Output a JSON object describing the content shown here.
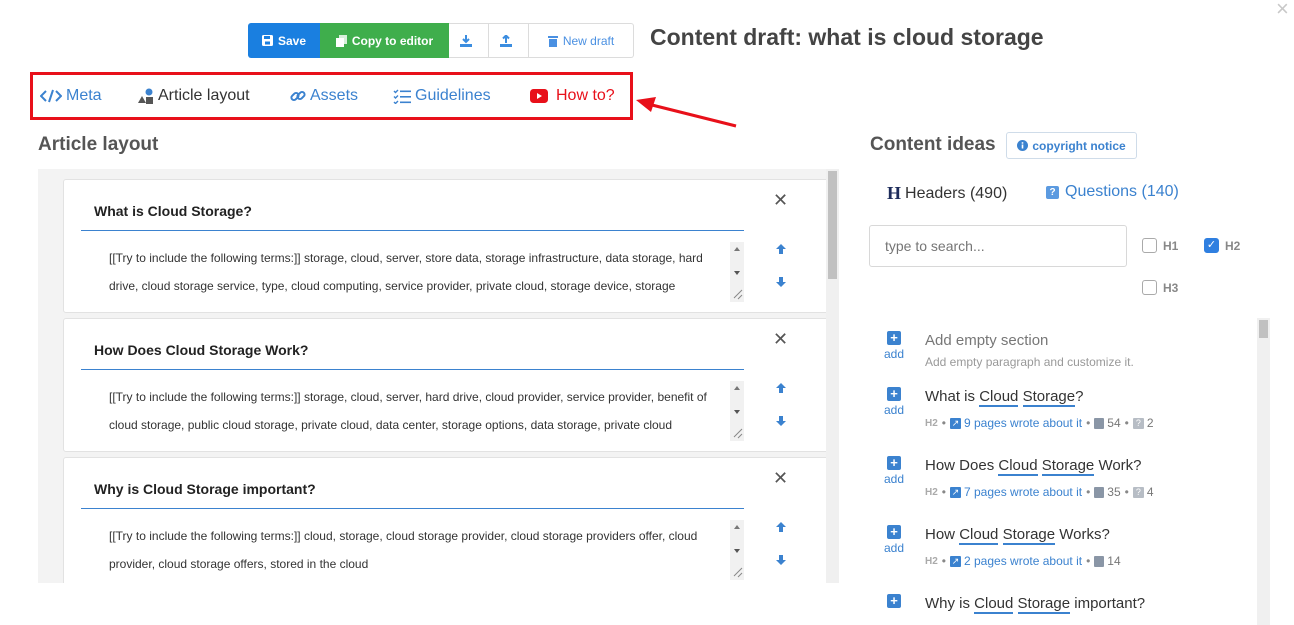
{
  "window": {
    "close_glyph": "×"
  },
  "toolbar": {
    "save_label": "Save",
    "copy_label": "Copy to editor",
    "new_draft_label": "New draft"
  },
  "page_title": "Content draft: what is cloud storage",
  "nav": {
    "meta": "Meta",
    "article_layout": "Article layout",
    "assets": "Assets",
    "guidelines": "Guidelines",
    "how_to": "How to?"
  },
  "layout": {
    "heading": "Article layout",
    "cards": [
      {
        "title": "What is Cloud Storage?",
        "text": "[[Try to include the following terms:]] storage, cloud, server, store data, storage infrastructure, data storage, hard drive, cloud storage service, type, cloud computing, service provider, private cloud, storage device, storage"
      },
      {
        "title": "How Does Cloud Storage Work?",
        "text": "[[Try to include the following terms:]] storage, cloud, server, hard drive, cloud provider, service provider, benefit of cloud storage, public cloud storage, private cloud, data center, storage options, data storage, private cloud"
      },
      {
        "title": "Why is Cloud Storage important?",
        "text": "[[Try to include the following terms:]] cloud, storage, cloud storage provider, cloud storage providers offer, cloud provider, cloud storage offers, stored in the cloud"
      }
    ]
  },
  "ideas": {
    "heading": "Content ideas",
    "copyright_label": "copyright notice",
    "tab_headers": "Headers (490)",
    "tab_questions": "Questions (140)",
    "search_placeholder": "type to search...",
    "filters": {
      "h1": "H1",
      "h2": "H2",
      "h3": "H3",
      "h2_checked": true
    },
    "add_label": "add",
    "empty": {
      "title": "Add empty section",
      "sub": "Add empty paragraph and customize it."
    },
    "items": [
      {
        "pre": "What is ",
        "kw1": "Cloud",
        "kw2": "Storage",
        "post": "?",
        "h": "H2",
        "pages": "9 pages wrote about it",
        "count": "54",
        "q": "2"
      },
      {
        "pre": "How Does ",
        "kw1": "Cloud",
        "kw2": "Storage",
        "post": " Work?",
        "h": "H2",
        "pages": "7 pages wrote about it",
        "count": "35",
        "q": "4"
      },
      {
        "pre": "How ",
        "kw1": "Cloud",
        "kw2": "Storage",
        "post": " Works?",
        "h": "H2",
        "pages": "2 pages wrote about it",
        "count": "14",
        "q": ""
      },
      {
        "pre": "Why is ",
        "kw1": "Cloud",
        "kw2": "Storage",
        "post": " important?",
        "h": "",
        "pages": "",
        "count": "",
        "q": ""
      }
    ]
  },
  "colors": {
    "primary": "#1a7fe0",
    "success": "#3fae4c",
    "highlight": "#e8101a",
    "link": "#3b82cf"
  }
}
